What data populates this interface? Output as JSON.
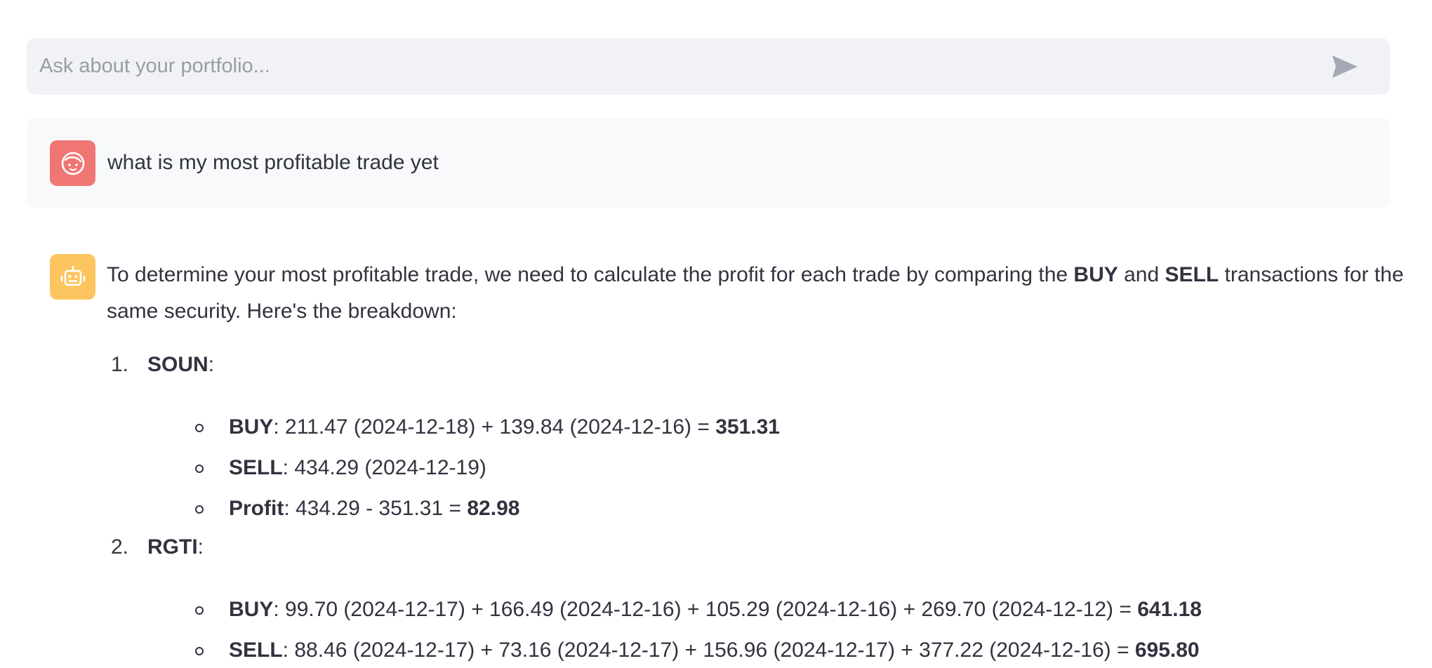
{
  "chat_input": {
    "placeholder": "Ask about your portfolio...",
    "value": "",
    "send_icon": "send-arrow-icon"
  },
  "user_message": {
    "avatar_icon": "user-face-icon",
    "text": "what is my most profitable trade yet"
  },
  "assistant_message": {
    "avatar_icon": "robot-icon",
    "intro": {
      "t1": "To determine your most profitable trade, we need to calculate the profit for each trade by comparing the ",
      "b1": "BUY",
      "t2": " and ",
      "b2": "SELL",
      "t3": " transactions for the same security. Here's the breakdown:"
    },
    "trades": [
      {
        "number": "1.",
        "security": "SOUN",
        "colon": ":",
        "buy_label": "BUY",
        "buy_text": ": 211.47 (2024-12-18) + 139.84 (2024-12-16) = ",
        "buy_total": "351.31",
        "sell_label": "SELL",
        "sell_text": ": 434.29 (2024-12-19)",
        "profit_label": "Profit",
        "profit_text": ": 434.29 - 351.31 = ",
        "profit_value": "82.98"
      },
      {
        "number": "2.",
        "security": "RGTI",
        "colon": ":",
        "buy_label": "BUY",
        "buy_text": ": 99.70 (2024-12-17) + 166.49 (2024-12-16) + 105.29 (2024-12-16) + 269.70 (2024-12-12) = ",
        "buy_total": "641.18",
        "sell_label": "SELL",
        "sell_text": ": 88.46 (2024-12-17) + 73.16 (2024-12-17) + 156.96 (2024-12-17) + 377.22 (2024-12-16) = ",
        "sell_total": "695.80"
      }
    ]
  },
  "colors": {
    "input_bg": "#f0f2f6",
    "user_avatar": "#f07673",
    "bot_avatar": "#fcc55f",
    "text": "#31333f"
  }
}
